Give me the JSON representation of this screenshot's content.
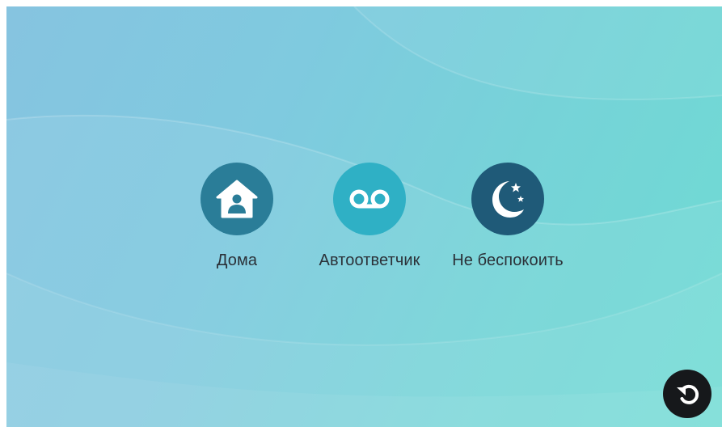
{
  "modes": [
    {
      "label": "Дома",
      "icon": "home-user-icon",
      "color": "#2a7d98"
    },
    {
      "label": "Автоответчик",
      "icon": "voicemail-icon",
      "color": "#2fb0c5"
    },
    {
      "label": "Не беспокоить",
      "icon": "moon-stars-icon",
      "color": "#1f5a78"
    }
  ],
  "back_button": {
    "icon": "back-arrow-icon",
    "color": "#16181b"
  },
  "colors": {
    "background_start": "#86c4e0",
    "background_end": "#6edbd3",
    "label_text": "#2b3138"
  }
}
